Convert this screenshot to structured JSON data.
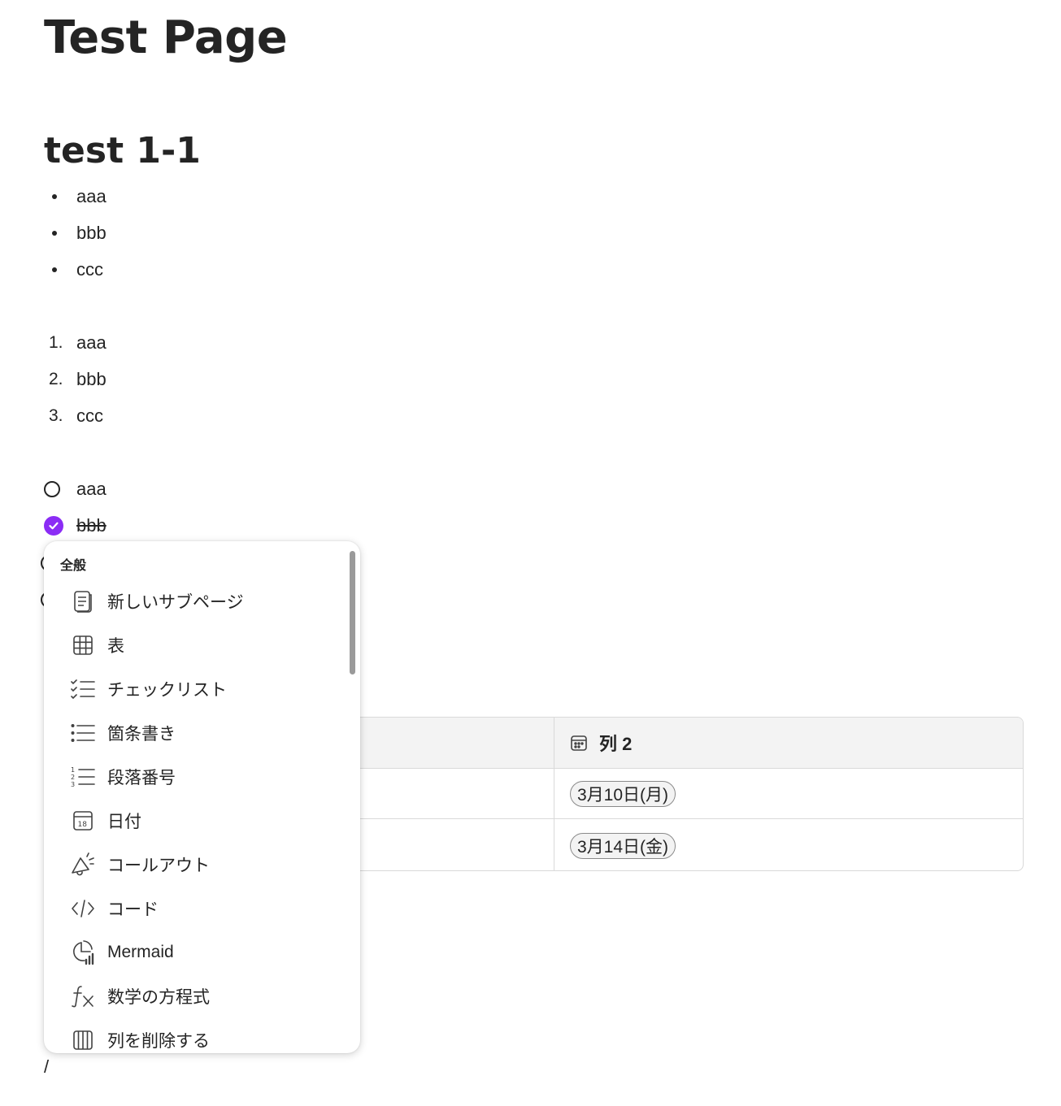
{
  "page": {
    "title": "Test Page"
  },
  "section": {
    "heading": "test 1-1"
  },
  "bullet_list": [
    "aaa",
    "bbb",
    "ccc"
  ],
  "numbered_list": [
    {
      "number": "1.",
      "text": "aaa"
    },
    {
      "number": "2.",
      "text": "bbb"
    },
    {
      "number": "3.",
      "text": "ccc"
    }
  ],
  "checklist": [
    {
      "text": "aaa",
      "checked": false
    },
    {
      "text": "bbb",
      "checked": true
    }
  ],
  "table": {
    "column2_header": "列 2",
    "rows": [
      {
        "col2": "3月10日(月)"
      },
      {
        "col2": "3月14日(金)"
      }
    ]
  },
  "menu": {
    "section_label": "全般",
    "items": [
      {
        "label": "新しいサブページ",
        "icon": "document-icon"
      },
      {
        "label": "表",
        "icon": "table-icon"
      },
      {
        "label": "チェックリスト",
        "icon": "checklist-icon"
      },
      {
        "label": "箇条書き",
        "icon": "bullet-list-icon"
      },
      {
        "label": "段落番号",
        "icon": "numbered-list-icon"
      },
      {
        "label": "日付",
        "icon": "calendar-icon"
      },
      {
        "label": "コールアウト",
        "icon": "megaphone-icon"
      },
      {
        "label": "コード",
        "icon": "code-icon"
      },
      {
        "label": "Mermaid",
        "icon": "chart-icon"
      },
      {
        "label": "数学の方程式",
        "icon": "function-icon"
      },
      {
        "label": "列を削除する",
        "icon": "delete-column-icon"
      }
    ]
  },
  "editor": {
    "slash_text": "/"
  },
  "colors": {
    "accent": "#8b2cf5",
    "text": "#242424",
    "border": "#d9d9d9"
  }
}
